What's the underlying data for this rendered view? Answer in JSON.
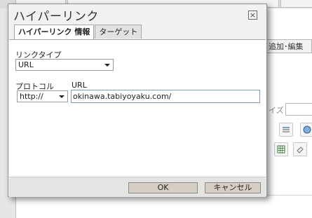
{
  "background": {
    "add_edit_label": "追加･編集",
    "size_label": "イズ",
    "tool_icons": [
      "list-icon",
      "globe-icon",
      "grid-icon",
      "eraser-icon"
    ]
  },
  "dialog": {
    "title": "ハイパーリンク",
    "close_glyph": "×",
    "tabs": [
      {
        "label": "ハイパーリンク 情報",
        "active": true
      },
      {
        "label": "ターゲット",
        "active": false
      }
    ],
    "link_type": {
      "label": "リンクタイプ",
      "value": "URL"
    },
    "protocol": {
      "label": "プロトコル",
      "value": "http://"
    },
    "url": {
      "label": "URL",
      "value": "okinawa.tabiyoyaku.com/"
    },
    "buttons": {
      "ok": "OK",
      "cancel": "キャンセル"
    }
  }
}
